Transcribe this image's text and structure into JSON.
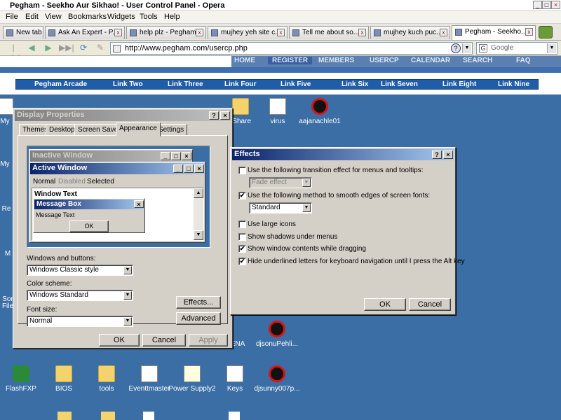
{
  "browser": {
    "title": "Pegham - Seekho Aur Sikhao! - User Control Panel - Opera",
    "menu": [
      "File",
      "Edit",
      "View",
      "Bookmarks",
      "Widgets",
      "Tools",
      "Help"
    ],
    "new_tab_label": "New tab",
    "tabs": [
      {
        "label": "Ask An Expert - P..."
      },
      {
        "label": "help plz - Pegham..."
      },
      {
        "label": "mujhey yeh site c..."
      },
      {
        "label": "Tell me about so..."
      },
      {
        "label": "mujhey kuch puc..."
      },
      {
        "label": "Pegham - Seekho...",
        "active": true
      }
    ],
    "address": "http://www.pegham.com/usercp.php",
    "search_placeholder": "Google"
  },
  "webpage": {
    "banner_links": [
      "HOME",
      "REGISTER",
      "MEMBERS",
      "USERCP",
      "CALENDAR",
      "SEARCH",
      "FAQ"
    ],
    "nav_links": [
      "Pegham Arcade",
      "Link Two",
      "Link Three",
      "Link Four",
      "Link Five",
      "Link Six",
      "Link Seven",
      "Link Eight",
      "Link Nine"
    ]
  },
  "desktop": {
    "icons": [
      {
        "label": "My"
      },
      {
        "label": "rShare"
      },
      {
        "label": "virus"
      },
      {
        "label": "aajanachle01"
      },
      {
        "label": "My"
      },
      {
        "label": "Re"
      },
      {
        "label": "M"
      },
      {
        "label": "Sor"
      },
      {
        "label": "File"
      },
      {
        "label": "ENA"
      },
      {
        "label": "djsonuPehli..."
      },
      {
        "label": "FlashFXP"
      },
      {
        "label": "BIOS"
      },
      {
        "label": "tools"
      },
      {
        "label": "Eventtmaster"
      },
      {
        "label": "Power Supply2"
      },
      {
        "label": "Keys"
      },
      {
        "label": "djsunny007p..."
      }
    ]
  },
  "display_properties": {
    "title": "Display Properties",
    "help_btn": "?",
    "close_btn": "×",
    "tabs": [
      "Themes",
      "Desktop",
      "Screen Saver",
      "Appearance",
      "Settings"
    ],
    "preview": {
      "inactive_title": "Inactive Window",
      "active_title": "Active Window",
      "menu_normal": "Normal",
      "menu_disabled": "Disabled",
      "menu_selected": "Selected",
      "window_text": "Window Text",
      "msgbox_title": "Message Box",
      "msgbox_text": "Message Text",
      "msgbox_ok": "OK"
    },
    "windows_buttons_label": "Windows and buttons:",
    "windows_buttons_value": "Windows Classic style",
    "color_scheme_label": "Color scheme:",
    "color_scheme_value": "Windows Standard",
    "font_size_label": "Font size:",
    "font_size_value": "Normal",
    "effects_btn": "Effects...",
    "advanced_btn": "Advanced",
    "ok_btn": "OK",
    "cancel_btn": "Cancel",
    "apply_btn": "Apply"
  },
  "effects": {
    "title": "Effects",
    "help_btn": "?",
    "close_btn": "×",
    "opt_transition": "Use the following transition effect for menus and tooltips:",
    "transition_value": "Fade effect",
    "opt_smooth": "Use the following method to smooth edges of screen fonts:",
    "smooth_value": "Standard",
    "opt_large_icons": "Use large icons",
    "opt_shadows": "Show shadows under menus",
    "opt_drag": "Show window contents while dragging",
    "opt_underline": "Hide underlined letters for keyboard navigation until I press the Alt key",
    "checked_mark": "✔",
    "ok_btn": "OK",
    "cancel_btn": "Cancel"
  },
  "colors": {
    "desktop": "#3a6ea5",
    "classic_face": "#d4d0c8",
    "active_title": "#0a246a"
  }
}
